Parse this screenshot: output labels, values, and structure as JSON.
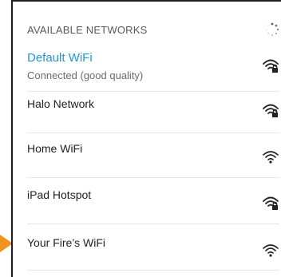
{
  "header": {
    "title": "AVAILABLE NETWORKS"
  },
  "networks": [
    {
      "name": "Default WiFi",
      "status": "Connected (good quality)",
      "icon": "wifi-locked-icon"
    },
    {
      "name": "Halo Network",
      "icon": "wifi-locked-icon"
    },
    {
      "name": "Home WiFi",
      "icon": "wifi-open-icon"
    },
    {
      "name": "iPad Hotspot",
      "icon": "wifi-locked-icon"
    },
    {
      "name": "Your Fire’s WiFi",
      "icon": "wifi-open-icon"
    }
  ],
  "colors": {
    "accent": "#1a9ad6",
    "pointer": "#f0941f",
    "border": "#1f1f1f"
  }
}
